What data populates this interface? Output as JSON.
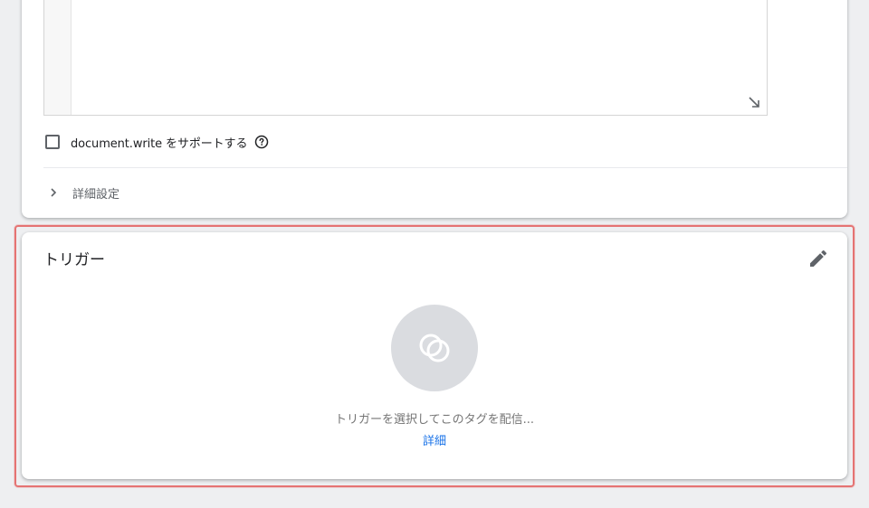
{
  "tag_config": {
    "document_write_checkbox": {
      "label": "document.write をサポートする",
      "checked": false
    },
    "advanced_settings_label": "詳細設定"
  },
  "triggering": {
    "title": "トリガー",
    "empty_message": "トリガーを選択してこのタグを配信...",
    "learn_more_label": "詳細"
  },
  "icons": {
    "resize": "resize-handle-icon",
    "help": "help-icon",
    "expand": "chevron-right-icon",
    "edit": "pencil-icon",
    "trigger_placeholder": "overlapping-circles-icon"
  },
  "colors": {
    "link": "#1a73e8",
    "highlight_border": "#e57373",
    "placeholder_circle": "#dadce0"
  }
}
